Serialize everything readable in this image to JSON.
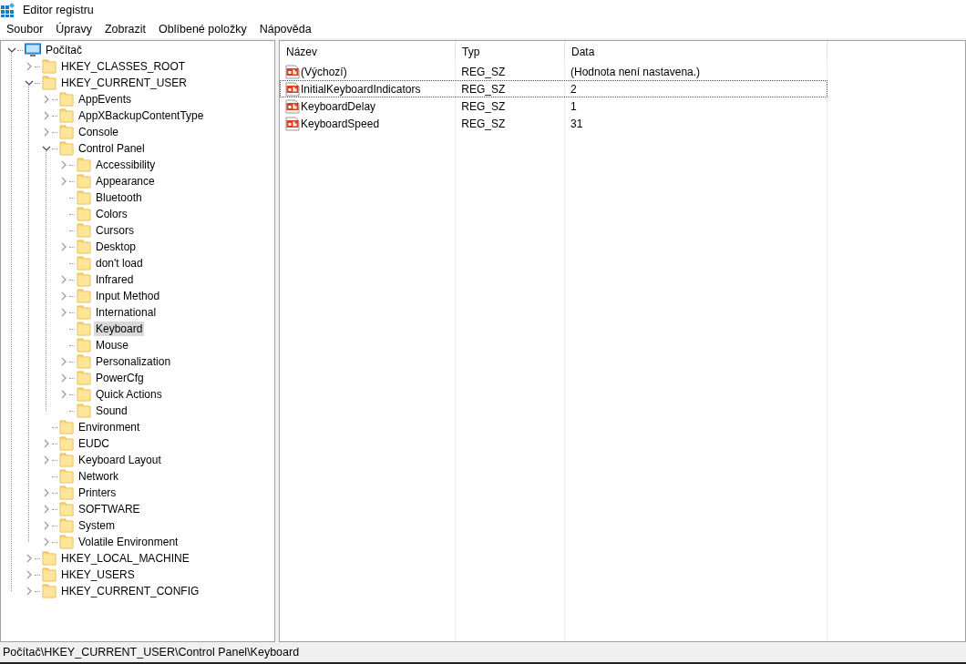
{
  "window": {
    "title": "Editor registru"
  },
  "menu": [
    "Soubor",
    "Úpravy",
    "Zobrazit",
    "Oblíbené položky",
    "Nápověda"
  ],
  "tree": [
    {
      "label": "Počítač",
      "kind": "computer",
      "expanded": true,
      "selected": false,
      "children": [
        {
          "label": "HKEY_CLASSES_ROOT",
          "kind": "folder",
          "expanded": false,
          "selected": false
        },
        {
          "label": "HKEY_CURRENT_USER",
          "kind": "folder",
          "expanded": true,
          "selected": false,
          "children": [
            {
              "label": "AppEvents",
              "kind": "folder",
              "expanded": false,
              "selected": false
            },
            {
              "label": "AppXBackupContentType",
              "kind": "folder",
              "expanded": false,
              "selected": false
            },
            {
              "label": "Console",
              "kind": "folder",
              "expanded": false,
              "selected": false
            },
            {
              "label": "Control Panel",
              "kind": "folder",
              "expanded": true,
              "selected": false,
              "children": [
                {
                  "label": "Accessibility",
                  "kind": "folder",
                  "expanded": false,
                  "selected": false
                },
                {
                  "label": "Appearance",
                  "kind": "folder",
                  "expanded": false,
                  "selected": false
                },
                {
                  "label": "Bluetooth",
                  "kind": "folder",
                  "selected": false
                },
                {
                  "label": "Colors",
                  "kind": "folder",
                  "selected": false
                },
                {
                  "label": "Cursors",
                  "kind": "folder",
                  "selected": false
                },
                {
                  "label": "Desktop",
                  "kind": "folder",
                  "expanded": false,
                  "selected": false
                },
                {
                  "label": "don't load",
                  "kind": "folder",
                  "selected": false
                },
                {
                  "label": "Infrared",
                  "kind": "folder",
                  "expanded": false,
                  "selected": false
                },
                {
                  "label": "Input Method",
                  "kind": "folder",
                  "expanded": false,
                  "selected": false
                },
                {
                  "label": "International",
                  "kind": "folder",
                  "expanded": false,
                  "selected": false
                },
                {
                  "label": "Keyboard",
                  "kind": "folder",
                  "selected": true
                },
                {
                  "label": "Mouse",
                  "kind": "folder",
                  "selected": false
                },
                {
                  "label": "Personalization",
                  "kind": "folder",
                  "expanded": false,
                  "selected": false
                },
                {
                  "label": "PowerCfg",
                  "kind": "folder",
                  "expanded": false,
                  "selected": false
                },
                {
                  "label": "Quick Actions",
                  "kind": "folder",
                  "expanded": false,
                  "selected": false
                },
                {
                  "label": "Sound",
                  "kind": "folder",
                  "selected": false
                }
              ]
            },
            {
              "label": "Environment",
              "kind": "folder",
              "selected": false
            },
            {
              "label": "EUDC",
              "kind": "folder",
              "expanded": false,
              "selected": false
            },
            {
              "label": "Keyboard Layout",
              "kind": "folder",
              "expanded": false,
              "selected": false
            },
            {
              "label": "Network",
              "kind": "folder",
              "selected": false
            },
            {
              "label": "Printers",
              "kind": "folder",
              "expanded": false,
              "selected": false
            },
            {
              "label": "SOFTWARE",
              "kind": "folder",
              "expanded": false,
              "selected": false
            },
            {
              "label": "System",
              "kind": "folder",
              "expanded": false,
              "selected": false
            },
            {
              "label": "Volatile Environment",
              "kind": "folder",
              "expanded": false,
              "selected": false
            }
          ]
        },
        {
          "label": "HKEY_LOCAL_MACHINE",
          "kind": "folder",
          "expanded": false,
          "selected": false
        },
        {
          "label": "HKEY_USERS",
          "kind": "folder",
          "expanded": false,
          "selected": false
        },
        {
          "label": "HKEY_CURRENT_CONFIG",
          "kind": "folder",
          "expanded": false,
          "selected": false
        }
      ]
    }
  ],
  "table": {
    "columns": [
      "Název",
      "Typ",
      "Data"
    ],
    "rows": [
      {
        "name": "(Výchozí)",
        "type": "REG_SZ",
        "data": "(Hodnota není nastavena.)",
        "selected": false
      },
      {
        "name": "InitialKeyboardIndicators",
        "type": "REG_SZ",
        "data": "2",
        "selected": true
      },
      {
        "name": "KeyboardDelay",
        "type": "REG_SZ",
        "data": "1",
        "selected": false
      },
      {
        "name": "KeyboardSpeed",
        "type": "REG_SZ",
        "data": "31",
        "selected": false
      }
    ]
  },
  "status_bar": "Počítač\\HKEY_CURRENT_USER\\Control Panel\\Keyboard"
}
